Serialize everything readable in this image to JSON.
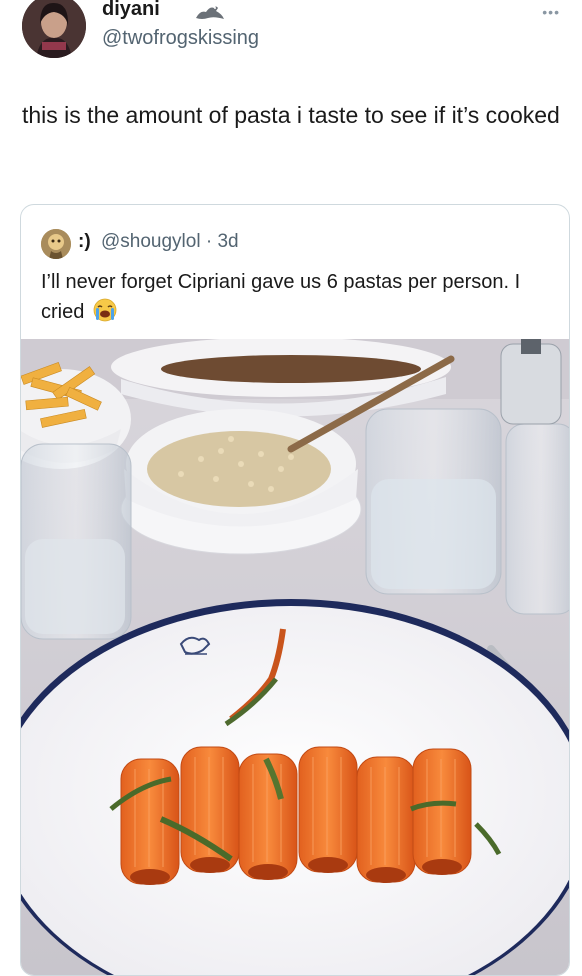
{
  "author": {
    "display_name": "diyani",
    "handle": "@twofrogskissing",
    "badge_icon": "seal-icon",
    "more_icon": "more-icon"
  },
  "tweet": {
    "text": "this is the amount of pasta i taste to see if it’s cooked"
  },
  "quoted": {
    "display_name": ":)",
    "handle": "@shougylol · 3d",
    "text": "I’ll never forget Cipriani gave us 6 pastas per person. I cried",
    "emoji_icon": "loudly-crying-face-icon"
  },
  "photo": {
    "pasta_pieces": 6
  }
}
